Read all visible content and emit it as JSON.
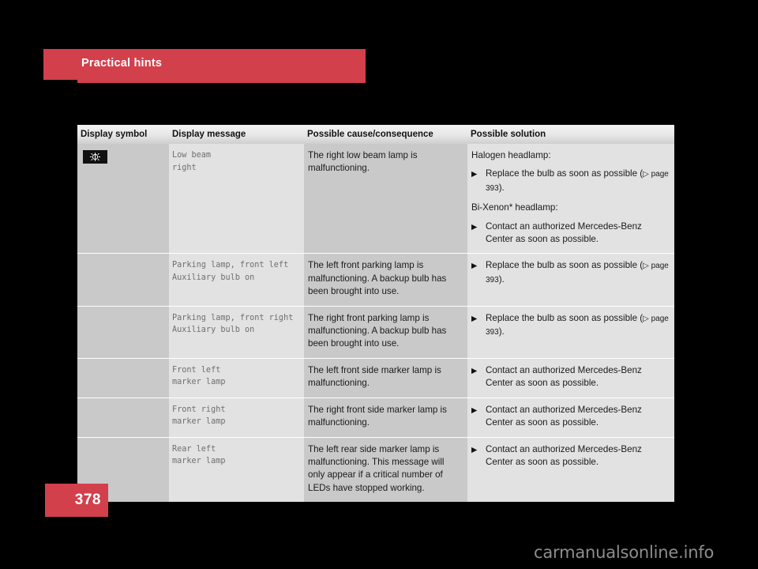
{
  "header": {
    "title": "Practical hints",
    "accent_color": "#d2404c"
  },
  "table": {
    "columns": [
      "Display symbol",
      "Display message",
      "Possible cause/consequence",
      "Possible solution"
    ],
    "rows": [
      {
        "symbol_icon": "low-beam-lamp-icon",
        "message": "Low beam\nright",
        "cause": "The right low beam lamp is malfunctioning.",
        "solution": {
          "blocks": [
            {
              "type": "lead",
              "text": "Halogen headlamp:"
            },
            {
              "type": "bullet",
              "text": "Replace the bulb as soon as possible (",
              "page_ref": "▷ page 393",
              "text_end": ")."
            },
            {
              "type": "lead",
              "text": "Bi-Xenon* headlamp:"
            },
            {
              "type": "bullet",
              "text": "Contact an authorized Mercedes-Benz Center as soon as possible.",
              "page_ref": "",
              "text_end": ""
            }
          ]
        }
      },
      {
        "symbol_icon": "",
        "message": "Parking lamp, front left\nAuxiliary bulb on",
        "cause": "The left front parking lamp is malfunctioning. A backup bulb has been brought into use.",
        "solution": {
          "blocks": [
            {
              "type": "bullet",
              "text": "Replace the bulb as soon as possible (",
              "page_ref": "▷ page 393",
              "text_end": ")."
            }
          ]
        }
      },
      {
        "symbol_icon": "",
        "message": "Parking lamp, front right\nAuxiliary bulb on",
        "cause": "The right front parking lamp is malfunctioning. A backup bulb has been brought into use.",
        "solution": {
          "blocks": [
            {
              "type": "bullet",
              "text": "Replace the bulb as soon as possible (",
              "page_ref": "▷ page 393",
              "text_end": ")."
            }
          ]
        }
      },
      {
        "symbol_icon": "",
        "message": "Front left\nmarker lamp",
        "cause": "The left front side marker lamp is malfunctioning.",
        "solution": {
          "blocks": [
            {
              "type": "bullet",
              "text": "Contact an authorized Mercedes-Benz Center as soon as possible.",
              "page_ref": "",
              "text_end": ""
            }
          ]
        }
      },
      {
        "symbol_icon": "",
        "message": "Front right\nmarker lamp",
        "cause": "The right front side marker lamp is malfunctioning.",
        "solution": {
          "blocks": [
            {
              "type": "bullet",
              "text": "Contact an authorized Mercedes-Benz Center as soon as possible.",
              "page_ref": "",
              "text_end": ""
            }
          ]
        }
      },
      {
        "symbol_icon": "",
        "message": "Rear left\nmarker lamp",
        "cause": "The left rear side marker lamp is malfunctioning. This message will only appear if a critical number of LEDs have stopped working.",
        "solution": {
          "blocks": [
            {
              "type": "bullet",
              "text": "Contact an authorized Mercedes-Benz Center as soon as possible.",
              "page_ref": "",
              "text_end": ""
            }
          ]
        }
      }
    ]
  },
  "footer": {
    "page_number": "378",
    "watermark": "carmanualsonline.info"
  }
}
